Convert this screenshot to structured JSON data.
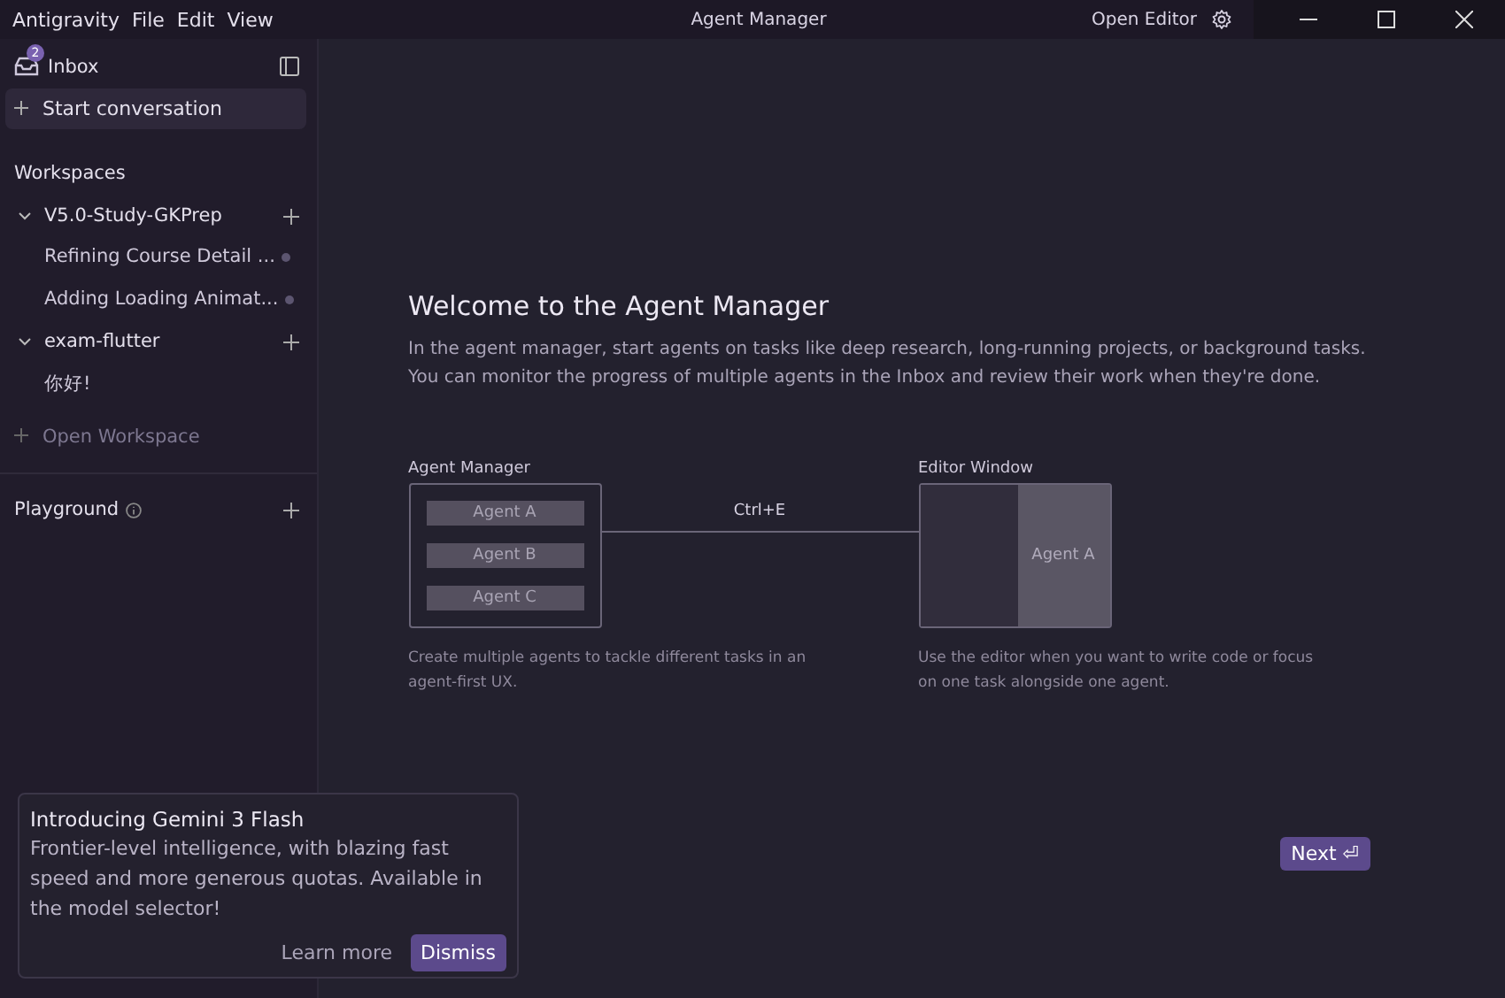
{
  "titlebar": {
    "menu": [
      "Antigravity",
      "File",
      "Edit",
      "View"
    ],
    "title": "Agent Manager",
    "open_editor": "Open Editor"
  },
  "sidebar": {
    "inbox": {
      "label": "Inbox",
      "badge": "2"
    },
    "start": "Start conversation",
    "workspaces_heading": "Workspaces",
    "workspaces": [
      {
        "name": "V5.0-Study-GKPrep",
        "expanded": true,
        "children": [
          {
            "title": "Refining Course Detail ...",
            "unread": true
          },
          {
            "title": "Adding Loading Animat...",
            "unread": true
          }
        ]
      },
      {
        "name": "exam-flutter",
        "expanded": true,
        "children": [
          {
            "title": "你好!",
            "unread": false
          }
        ]
      }
    ],
    "open_workspace": "Open Workspace",
    "playground": "Playground"
  },
  "welcome": {
    "title": "Welcome to the Agent Manager",
    "body": "In the agent manager, start agents on tasks like deep research, long-running projects, or background tasks. You can monitor the progress of multiple agents in the Inbox and review their work when they're done.",
    "left": {
      "label": "Agent Manager",
      "agents": [
        "Agent A",
        "Agent B",
        "Agent C"
      ],
      "caption": "Create multiple agents to tackle different tasks in an agent-first UX."
    },
    "shortcut": "Ctrl+E",
    "right": {
      "label": "Editor Window",
      "agent": "Agent A",
      "caption": "Use the editor when you want to write code or focus on one task alongside one agent."
    },
    "next": "Next ⏎"
  },
  "toast": {
    "title": "Introducing Gemini 3 Flash",
    "body": "Frontier-level intelligence, with blazing fast speed and more generous quotas. Available in the model selector!",
    "learn_more": "Learn more",
    "dismiss": "Dismiss"
  }
}
